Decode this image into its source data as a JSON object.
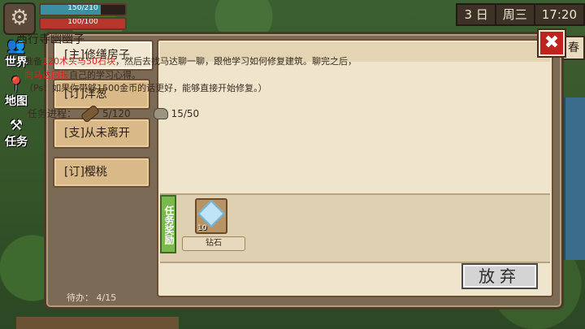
{
  "hud": {
    "energy_text": "150/210",
    "energy_fraction": 0.714,
    "health_text": "100/100",
    "health_fraction": 1.0,
    "day": "3 日",
    "weekday": "周三",
    "time": "17:20",
    "season": "春"
  },
  "side_buttons": {
    "world": "世界",
    "map": "地图",
    "task": "任务"
  },
  "tabs": [
    {
      "label": "[主]修缮房子",
      "active": true
    },
    {
      "label": "[订]洋葱",
      "active": false
    },
    {
      "label": "[支]从未离开",
      "active": false
    },
    {
      "label": "[订]樱桃",
      "active": false
    }
  ],
  "pending": "待办： 4/15",
  "quest": {
    "title": "西行寺幽幽子",
    "desc_1a": "准备",
    "desc_1b": "120木头与50石块",
    "desc_1c": "，然后去找马达聊一聊，跟他学习如何修复建筑。聊完之后，",
    "desc_2a": "向马达回报",
    "desc_2b": "自己的学习心得。",
    "desc_3": "（Ps：如果你带够1500金币的话更好，能够直接开始修复。）",
    "progress_label": "任务进程：",
    "wood_progress": "5/120",
    "stone_progress": "15/50",
    "reward_label": "任务奖励",
    "reward_count": "10",
    "reward_name": "钻石",
    "abandon": "放弃"
  },
  "colors": {
    "highlight": "#e02020",
    "reward_tag": "#7ab94b",
    "close_button": "#c0231e"
  },
  "icons": [
    "gear-icon",
    "close-icon",
    "wood-icon",
    "stone-icon",
    "diamond-icon"
  ]
}
